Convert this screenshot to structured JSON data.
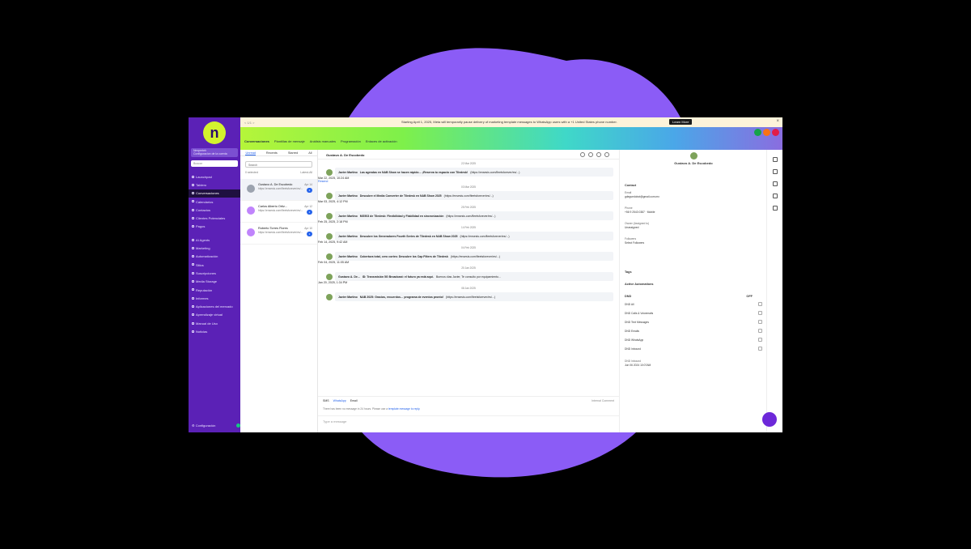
{
  "banner": {
    "nav": "< 1/1 >",
    "message": "Starting April 1, 2025, Meta will temporarily pause delivery of marketing template messages to WhatsApp users with a +1 United States phone number.",
    "learn_more": "Learn More"
  },
  "sidebar": {
    "logo": "n",
    "account_name": "Nexperteh",
    "account_sub": "Configuracion de la cuenta",
    "search_placeholder": "Buscar",
    "items": [
      {
        "label": "Launchpad"
      },
      {
        "label": "Tablero"
      },
      {
        "label": "Conversaciones",
        "active": true
      },
      {
        "label": "Calendarios"
      },
      {
        "label": "Contactos"
      },
      {
        "label": "Clientes Potenciales"
      },
      {
        "label": "Pagos"
      }
    ],
    "items2": [
      {
        "label": "AI Agents"
      },
      {
        "label": "Marketing"
      },
      {
        "label": "Automatización"
      },
      {
        "label": "Sitios"
      },
      {
        "label": "Suscripciones"
      },
      {
        "label": "Media Storage"
      },
      {
        "label": "Reputación"
      },
      {
        "label": "Informes"
      },
      {
        "label": "Aplicaciones del mercado"
      },
      {
        "label": "Aprendizaje virtual"
      },
      {
        "label": "Manual de Uso"
      },
      {
        "label": "Noticias"
      }
    ],
    "settings": "Configuración"
  },
  "topbar": {
    "tabs": [
      "Conversaciones",
      "Plantillas de mensaje",
      "Análisis manuales",
      "Programación",
      "Enlaces de activación"
    ]
  },
  "colors": {
    "sidebar": "#5b21b6",
    "accent": "#2563eb",
    "logo": "#d3f32e",
    "purple_blob": "#8b5cf6"
  },
  "conv_list": {
    "tabs": [
      "Unread",
      "Recents",
      "Starred",
      "All"
    ],
    "search_placeholder": "Search",
    "select_label": "0 selected",
    "sort_label": "Latest-All",
    "items": [
      {
        "name": "Gustavo A. De Escobedo",
        "preview": "https://ensesis.com/fleetsforever/es/...",
        "date": "Apr 14",
        "badge": "2"
      },
      {
        "name": "Carlos Alberto Ortiz...",
        "preview": "https://ensesis.com/fleetsforever/es/...",
        "date": "Apr 12",
        "badge": "1"
      },
      {
        "name": "Roberto Torres Flores",
        "preview": "https://ensesis.com/fleetsforever/es/...",
        "date": "Apr 10",
        "badge": "1"
      }
    ]
  },
  "chat": {
    "title": "Gustavo A. De Escobedo",
    "messages": [
      {
        "day": "22 Mar 2025",
        "sender": "Javier Martino",
        "subject": "Las agendas en NAB Show se hacen rápido… ¡Reserva tu espacio con Tiledesk!",
        "body": "(https://ensesis.com/fleetsforever/es/...)",
        "time": "Mar 22, 2025, 10:24 AM"
      },
      {
        "day": "03 Mar 2025",
        "sender": "Javier Martino",
        "subject": "Descubre el Media Converter de Tiledesk en NAB Show 2025",
        "body": "(https://ensesis.com/fleetsforever/es/...)",
        "time": "Mar 03, 2025, 4:12 PM"
      },
      {
        "day": "25 Feb 2025",
        "sender": "Javier Martino",
        "subject": "MG503 de Tiledesk: Flexibilidad y Fiabilidad en sincronización",
        "body": "(https://ensesis.com/fleetsforever/es/...)",
        "time": "Feb 25, 2025, 2:18 PM"
      },
      {
        "day": "14 Feb 2025",
        "sender": "Javier Martino",
        "subject": "Descubre los Generadores Fourth Series de Tiledesk en NAB Show 2025",
        "body": "(https://ensesis.com/fleetsforever/es/...)",
        "time": "Feb 14, 2025, 9:42 AM"
      },
      {
        "day": "04 Feb 2025",
        "sender": "Javier Martino",
        "subject": "Cobertura total, cero cortes: Descubre los Cap Filters de Tiledesk",
        "body": "(https://ensesis.com/fleetsforever/es/...)",
        "time": "Feb 04, 2025, 11:05 AM"
      },
      {
        "day": "20 Jan 2025",
        "sender": "Gustavo A. De...",
        "subject": "ID: Transmisión 5G Broadcast: el futuro ya está aquí.",
        "body": "Buenos días Javier, Te consulto por equipamiento...",
        "time": "Jan 20, 2025, 1:34 PM"
      },
      {
        "day": "08 Jan 2025",
        "sender": "Javier Martino",
        "subject": "NAB 2025: Gracias, recuerdos… programa de eventos pronto!",
        "body": "(https://ensesis.com/fleetsforever/es/...)",
        "time": ""
      }
    ],
    "resend": "Resend",
    "reply_tabs": [
      "SMS",
      "WhatsApp",
      "Email"
    ],
    "internal_comment": "Internal Comment",
    "notice": "There has been no message in 24 hours. Please use a ",
    "notice_link": "template message to reply.",
    "editor_placeholder": "Type a message"
  },
  "right_panel": {
    "name": "Gustavo A. De Escobedo",
    "contact_title": "Contact",
    "email_label": "Email",
    "email_value": "gdeguedobot@gmail.com.mx",
    "phone_label": "Phone",
    "phone_value": "+56 9 2543 0387",
    "phone_tag": "Mobile",
    "owner_label": "Owner (Assigned to)",
    "owner_value": "Unassigned",
    "followers_label": "Followers",
    "followers_value": "Select Followers",
    "tags_title": "Tags",
    "auto_title": "Active Automations",
    "dnd_label": "DND",
    "dnd_value": "OFF",
    "channels": [
      "DND All",
      "DND Calls & Voicemails",
      "DND Text Messages",
      "DND Emails",
      "DND WhatsApp",
      "DND Inbound"
    ],
    "last_label": "DND Inbound",
    "last_value": "Jun 06 2024 10:07AM"
  }
}
